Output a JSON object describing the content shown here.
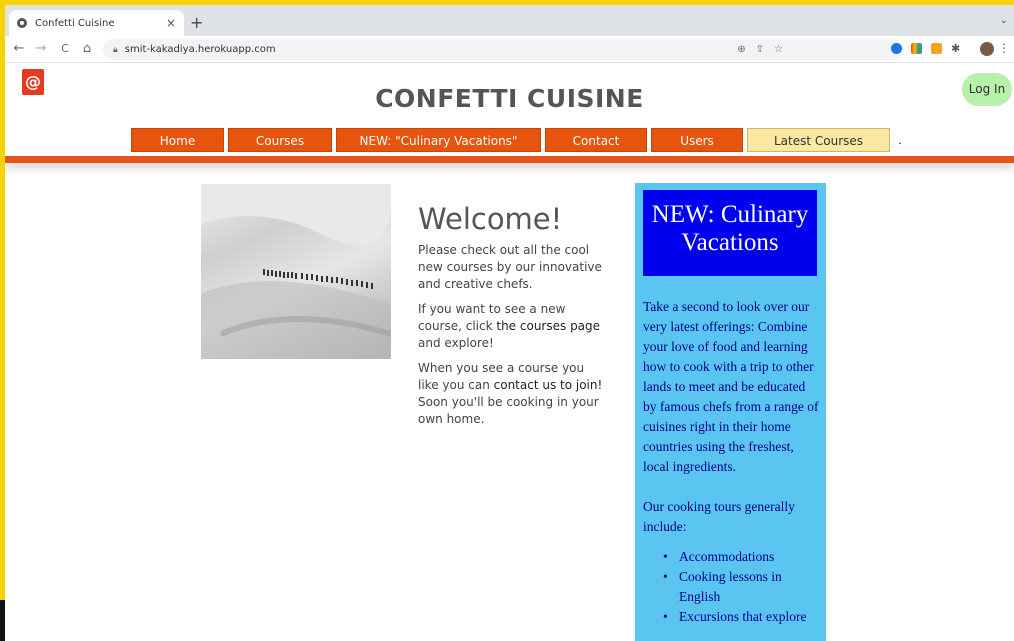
{
  "browser": {
    "tab_title": "Confetti Cuisine",
    "tab_close": "×",
    "new_tab": "+",
    "tab_menu": "⌄",
    "url": "smit-kakadiya.herokuapp.com",
    "back": "←",
    "forward": "→",
    "reload": "C",
    "home": "⌂"
  },
  "header": {
    "logo": "@",
    "title": "CONFETTI CUISINE",
    "login": "Log In"
  },
  "nav": {
    "items": [
      "Home",
      "Courses",
      "NEW: \"Culinary Vacations\"",
      "Contact",
      "Users",
      "Latest Courses"
    ],
    "trailing": "."
  },
  "welcome": {
    "heading": "Welcome!",
    "p1": "Please check out all the cool new courses by our innovative and creative chefs.",
    "p2_before": "If you want to see a new course, click ",
    "p2_link": "the courses page",
    "p2_after": " and explore!",
    "p3_before": "When you see a course you like you can ",
    "p3_link": "contact us to join!",
    "p3_after": " Soon you'll be cooking in your own home."
  },
  "sidebar": {
    "heading": "NEW: Culinary Vacations",
    "p1": "Take a second to look over our very latest offerings: Combine your love of food and learning how to cook with a trip to other lands to meet and be educated by famous chefs from a range of cuisines right in their home countries using the freshest, local ingredients.",
    "p2": "Our cooking tours generally include:",
    "items": [
      "Accommodations",
      "Cooking lessons in English",
      "Excursions that explore"
    ]
  },
  "colors": {
    "nav_orange": "#e8530e",
    "sidebar_bg": "#5bc5f2",
    "sidebar_head": "#0000ee",
    "login_bg": "#b7f0a8",
    "frame": "#f6d400"
  }
}
